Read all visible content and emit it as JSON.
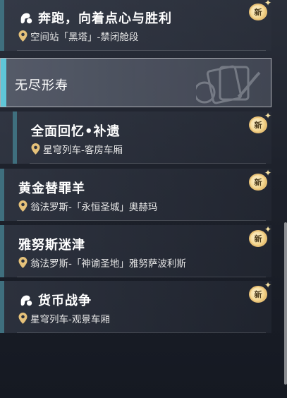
{
  "missions": [
    {
      "title": "奔跑，向着点心与胜利",
      "location": "空间站「黑塔」-禁闭舱段",
      "badge": "新",
      "icon": "companion-mission-icon"
    },
    {
      "title": "全面回忆•补遗",
      "location": "星穹列车-客房车厢",
      "badge": "新"
    },
    {
      "title": "黄金替罪羊",
      "location": "翁法罗斯-「永恒圣城」奥赫玛",
      "badge": "新"
    },
    {
      "title": "雅努斯迷津",
      "location": "翁法罗斯-「神谕圣地」雅努萨波利斯",
      "badge": "新"
    },
    {
      "title": "货币战争",
      "location": "星穹列车-观景车厢",
      "badge": "新",
      "icon": "companion-mission-icon"
    }
  ],
  "chapter": {
    "label": "无尽形寿"
  },
  "icons": {
    "location": "location-pin-icon",
    "new_badge": "new-badge-icon",
    "chapter_emblem": "chapter-emblem-icon"
  },
  "colors": {
    "accent_teal": "#3f6f7e",
    "chapter_accent": "#5fc6d8",
    "badge_gold": "#e9c277"
  }
}
